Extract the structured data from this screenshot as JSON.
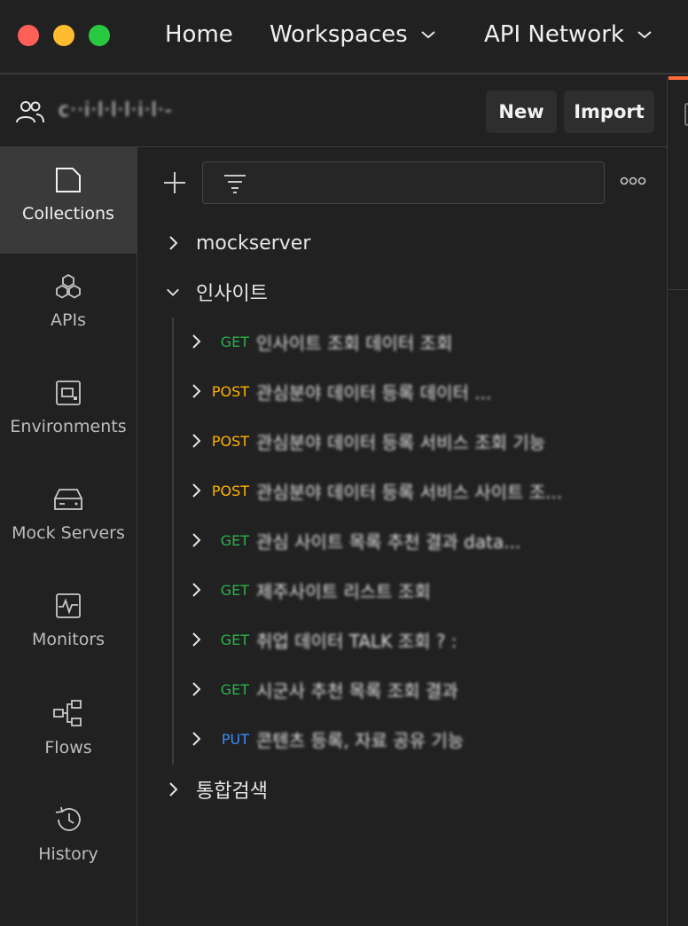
{
  "nav": {
    "home": "Home",
    "workspaces": "Workspaces",
    "api_network": "API Network"
  },
  "workspace": {
    "name": "c··i·l·l·l·i·l·-",
    "new_label": "New",
    "import_label": "Import"
  },
  "sidebar": {
    "items": [
      {
        "label": "Collections",
        "icon": "collections-icon",
        "active": true
      },
      {
        "label": "APIs",
        "icon": "apis-icon",
        "active": false
      },
      {
        "label": "Environments",
        "icon": "environments-icon",
        "active": false
      },
      {
        "label": "Mock Servers",
        "icon": "mock-servers-icon",
        "active": false
      },
      {
        "label": "Monitors",
        "icon": "monitors-icon",
        "active": false
      },
      {
        "label": "Flows",
        "icon": "flows-icon",
        "active": false
      },
      {
        "label": "History",
        "icon": "history-icon",
        "active": false
      }
    ]
  },
  "collections": [
    {
      "name": "mockserver",
      "expanded": false
    },
    {
      "name": "인사이트",
      "expanded": true
    },
    {
      "name": "통합검색",
      "expanded": false
    }
  ],
  "requests": [
    {
      "method": "GET",
      "name": "인사이트 조회 데이터 조회"
    },
    {
      "method": "POST",
      "name": "관심분야 데이터 등록 데이터 ..."
    },
    {
      "method": "POST",
      "name": "관심분야 데이터 등록 서비스 조회 기능"
    },
    {
      "method": "POST",
      "name": "관심분야 데이터 등록 서비스 사이트 조..."
    },
    {
      "method": "GET",
      "name": "관심 사이트 목록 추천 결과 data..."
    },
    {
      "method": "GET",
      "name": "제주사이트 리스트 조회"
    },
    {
      "method": "GET",
      "name": "취업 데이터 TALK 조회 ? :"
    },
    {
      "method": "GET",
      "name": "시군사 추천 목록 조회 결과"
    },
    {
      "method": "PUT",
      "name": "콘텐츠 등록, 자료 공유 기능"
    }
  ],
  "colors": {
    "get": "#2bb14c",
    "post": "#ffb400",
    "put": "#3b8bff",
    "accent": "#ff6c37"
  }
}
